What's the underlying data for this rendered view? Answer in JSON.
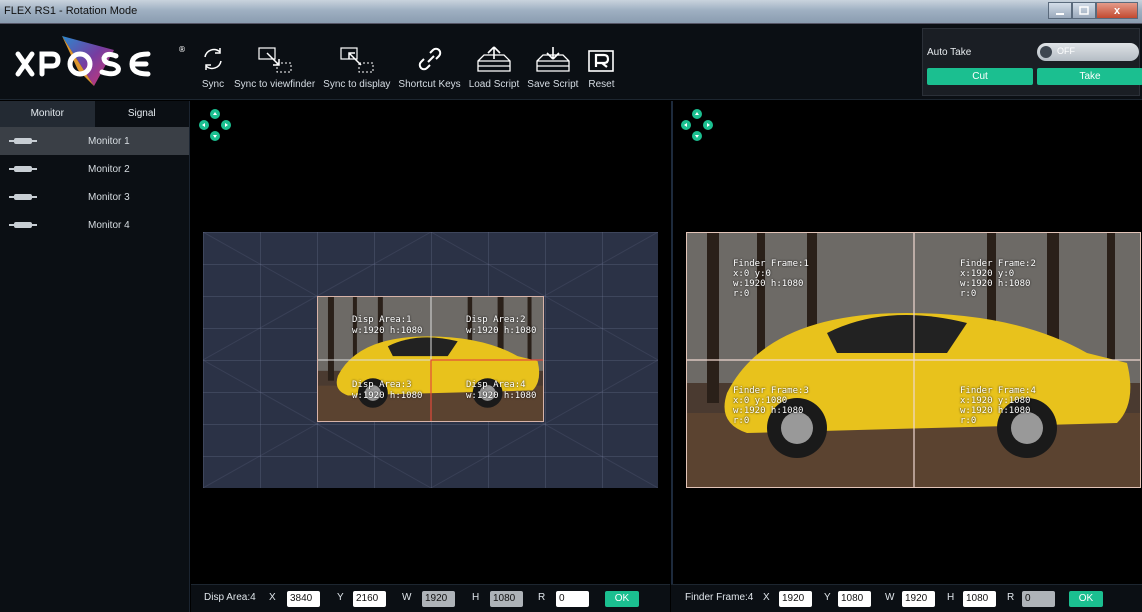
{
  "window": {
    "title": "FLEX RS1 - Rotation Mode",
    "close_label": "x"
  },
  "logo": {
    "text": "XPOSE"
  },
  "toolbar": {
    "items": [
      {
        "label": "Sync",
        "icon": "sync-icon"
      },
      {
        "label": "Sync to viewfinder",
        "icon": "sync-to-viewfinder-icon"
      },
      {
        "label": "Sync to display",
        "icon": "sync-to-display-icon"
      },
      {
        "label": "Shortcut Keys",
        "icon": "link-icon"
      },
      {
        "label": "Load Script",
        "icon": "load-script-icon"
      },
      {
        "label": "Save Script",
        "icon": "save-script-icon"
      },
      {
        "label": "Reset",
        "icon": "reset-icon"
      }
    ]
  },
  "auto_take": {
    "label": "Auto Take",
    "toggle_state": "OFF",
    "cut_label": "Cut",
    "take_label": "Take"
  },
  "sidebar": {
    "tabs": [
      {
        "label": "Monitor"
      },
      {
        "label": "Signal"
      }
    ],
    "active_tab": "Monitor",
    "items": [
      {
        "label": "Monitor  1",
        "selected": true
      },
      {
        "label": "Monitor  2",
        "selected": false
      },
      {
        "label": "Monitor  3",
        "selected": false
      },
      {
        "label": "Monitor  4",
        "selected": false
      }
    ]
  },
  "display_areas": [
    {
      "title": "Disp Area:1",
      "size": "w:1920  h:1080"
    },
    {
      "title": "Disp Area:2",
      "size": "w:1920  h:1080"
    },
    {
      "title": "Disp Area:3",
      "size": "w:1920  h:1080"
    },
    {
      "title": "Disp Area:4",
      "size": "w:1920  h:1080"
    }
  ],
  "finder_frames": [
    {
      "title": "Finder Frame:1",
      "pos": "x:0  y:0",
      "size": "w:1920  h:1080",
      "rot": "r:0"
    },
    {
      "title": "Finder Frame:2",
      "pos": "x:1920  y:0",
      "size": "w:1920  h:1080",
      "rot": "r:0"
    },
    {
      "title": "Finder Frame:3",
      "pos": "x:0  y:1080",
      "size": "w:1920  h:1080",
      "rot": "r:0"
    },
    {
      "title": "Finder Frame:4",
      "pos": "x:1920  y:1080",
      "size": "w:1920  h:1080",
      "rot": "r:0"
    }
  ],
  "disp_controls": {
    "name": "Disp Area:4",
    "x_label": "X",
    "x": "3840",
    "y_label": "Y",
    "y": "2160",
    "w_label": "W",
    "w": "1920",
    "h_label": "H",
    "h": "1080",
    "r_label": "R",
    "r": "0",
    "ok": "OK"
  },
  "finder_controls": {
    "name": "Finder Frame:4",
    "x_label": "X",
    "x": "1920",
    "y_label": "Y",
    "y": "1080",
    "w_label": "W",
    "w": "1920",
    "h_label": "H",
    "h": "1080",
    "r_label": "R",
    "r": "0",
    "ok": "OK"
  },
  "colors": {
    "accent_green": "#1bbf90",
    "logo_blue": "#2d8fd8",
    "logo_pink": "#e23a74",
    "car_yellow": "#e8c21c"
  }
}
